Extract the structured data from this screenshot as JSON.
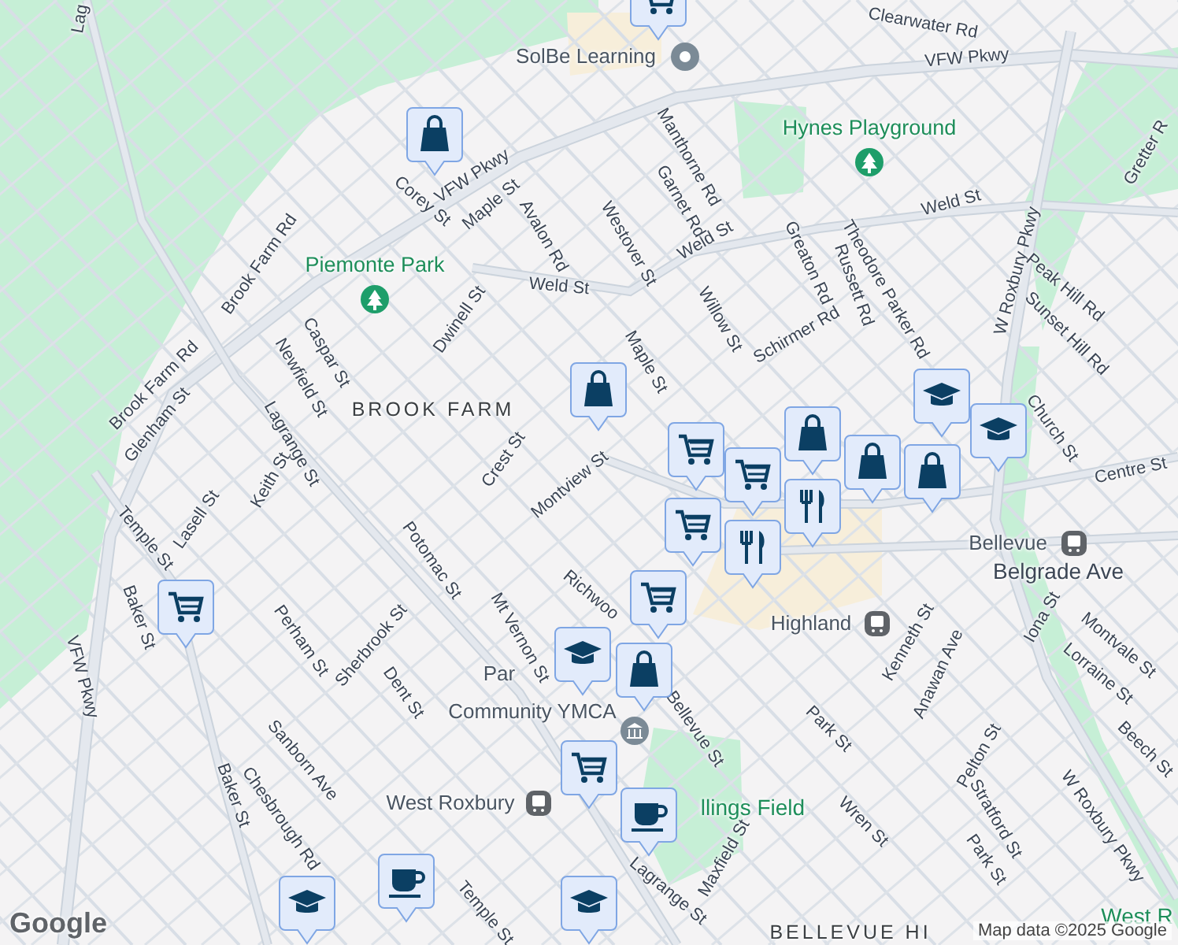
{
  "map": {
    "labels": [
      {
        "text": "Lag",
        "kind": "street"
      },
      {
        "text": "VFW Pkwy",
        "kind": "street"
      },
      {
        "text": "VFW Pkwy",
        "kind": "street"
      },
      {
        "text": "VFW Pkwy",
        "kind": "street"
      },
      {
        "text": "Corey St",
        "kind": "street"
      },
      {
        "text": "Maple St",
        "kind": "street"
      },
      {
        "text": "Avalon Rd",
        "kind": "street"
      },
      {
        "text": "Brook Farm Rd",
        "kind": "street"
      },
      {
        "text": "Brook Farm Rd",
        "kind": "street"
      },
      {
        "text": "Weld St",
        "kind": "street"
      },
      {
        "text": "Weld St",
        "kind": "street"
      },
      {
        "text": "Weld St",
        "kind": "street"
      },
      {
        "text": "Dwinell St",
        "kind": "street"
      },
      {
        "text": "Caspar St",
        "kind": "street"
      },
      {
        "text": "Newfield St",
        "kind": "street"
      },
      {
        "text": "Lagrange St",
        "kind": "street"
      },
      {
        "text": "Glenham St",
        "kind": "street"
      },
      {
        "text": "Keith St",
        "kind": "street"
      },
      {
        "text": "Crest St",
        "kind": "street"
      },
      {
        "text": "Montview St",
        "kind": "street"
      },
      {
        "text": "Lasell St",
        "kind": "street"
      },
      {
        "text": "Temple St",
        "kind": "street"
      },
      {
        "text": "Baker St",
        "kind": "street"
      },
      {
        "text": "Baker St",
        "kind": "street"
      },
      {
        "text": "Potomac St",
        "kind": "street"
      },
      {
        "text": "Perham St",
        "kind": "street"
      },
      {
        "text": "Sherbrook St",
        "kind": "street"
      },
      {
        "text": "Dent St",
        "kind": "street"
      },
      {
        "text": "Mt Vernon St",
        "kind": "street"
      },
      {
        "text": "Richwoo",
        "kind": "street"
      },
      {
        "text": "Sanborn Ave",
        "kind": "street"
      },
      {
        "text": "Chesbrough Rd",
        "kind": "street"
      },
      {
        "text": "Temple St",
        "kind": "street"
      },
      {
        "text": "Westover St",
        "kind": "street"
      },
      {
        "text": "Manthorne Rd",
        "kind": "street"
      },
      {
        "text": "Garnet Rd",
        "kind": "street"
      },
      {
        "text": "Maple St",
        "kind": "street"
      },
      {
        "text": "Willow St",
        "kind": "street"
      },
      {
        "text": "Greaton Rd",
        "kind": "street"
      },
      {
        "text": "Russett Rd",
        "kind": "street"
      },
      {
        "text": "Schirmer Rd",
        "kind": "street"
      },
      {
        "text": "Theodore Parker Rd",
        "kind": "street"
      },
      {
        "text": "W Roxbury Pkwy",
        "kind": "street"
      },
      {
        "text": "Peak Hill Rd",
        "kind": "street"
      },
      {
        "text": "Sunset Hill Rd",
        "kind": "street"
      },
      {
        "text": "Gretter R",
        "kind": "street"
      },
      {
        "text": "Clearwater Rd",
        "kind": "street"
      },
      {
        "text": "Church St",
        "kind": "street"
      },
      {
        "text": "Centre St",
        "kind": "street"
      },
      {
        "text": "Belgrade Ave",
        "kind": "major"
      },
      {
        "text": "Kenneth St",
        "kind": "street"
      },
      {
        "text": "Anawan Ave",
        "kind": "street"
      },
      {
        "text": "Iona St",
        "kind": "street"
      },
      {
        "text": "Montvale St",
        "kind": "street"
      },
      {
        "text": "Lorraine St",
        "kind": "street"
      },
      {
        "text": "Beech St",
        "kind": "street"
      },
      {
        "text": "Park St",
        "kind": "street"
      },
      {
        "text": "Pelton St",
        "kind": "street"
      },
      {
        "text": "Stratford St",
        "kind": "street"
      },
      {
        "text": "Park St",
        "kind": "street"
      },
      {
        "text": "Wren St",
        "kind": "street"
      },
      {
        "text": "Bellevue St",
        "kind": "street"
      },
      {
        "text": "Maxfield St",
        "kind": "street"
      },
      {
        "text": "Lagrange St",
        "kind": "street"
      },
      {
        "text": "W Roxbury Pkwy",
        "kind": "street"
      },
      {
        "text": "SolBe Learning",
        "kind": "poi"
      },
      {
        "text": "Hynes Playground",
        "kind": "park"
      },
      {
        "text": "Piemonte Park",
        "kind": "park"
      },
      {
        "text": "BROOK FARM",
        "kind": "area"
      },
      {
        "text": "Bellevue",
        "kind": "transit"
      },
      {
        "text": "Highland",
        "kind": "transit"
      },
      {
        "text": "Par",
        "kind": "plain"
      },
      {
        "text": "Community YMCA",
        "kind": "civic"
      },
      {
        "text": "West Roxbury",
        "kind": "transit"
      },
      {
        "text": "llings Field",
        "kind": "parkname"
      },
      {
        "text": "BELLEVUE HI",
        "kind": "area"
      },
      {
        "text": "West R",
        "kind": "parkname"
      }
    ],
    "pins": [
      {
        "kind": "shopping"
      },
      {
        "kind": "shopping"
      },
      {
        "kind": "cart"
      },
      {
        "kind": "cart"
      },
      {
        "kind": "school"
      },
      {
        "kind": "school"
      },
      {
        "kind": "shopping"
      },
      {
        "kind": "cart"
      },
      {
        "kind": "shopping"
      },
      {
        "kind": "shopping"
      },
      {
        "kind": "cart"
      },
      {
        "kind": "restaurant"
      },
      {
        "kind": "cart"
      },
      {
        "kind": "shopping"
      },
      {
        "kind": "school"
      },
      {
        "kind": "cart"
      },
      {
        "kind": "cafe"
      },
      {
        "kind": "cafe"
      },
      {
        "kind": "school"
      },
      {
        "kind": "school"
      },
      {
        "kind": "restaurant"
      },
      {
        "kind": "cart"
      }
    ],
    "logo": "Google",
    "attribution": "Map data ©2025 Google"
  }
}
